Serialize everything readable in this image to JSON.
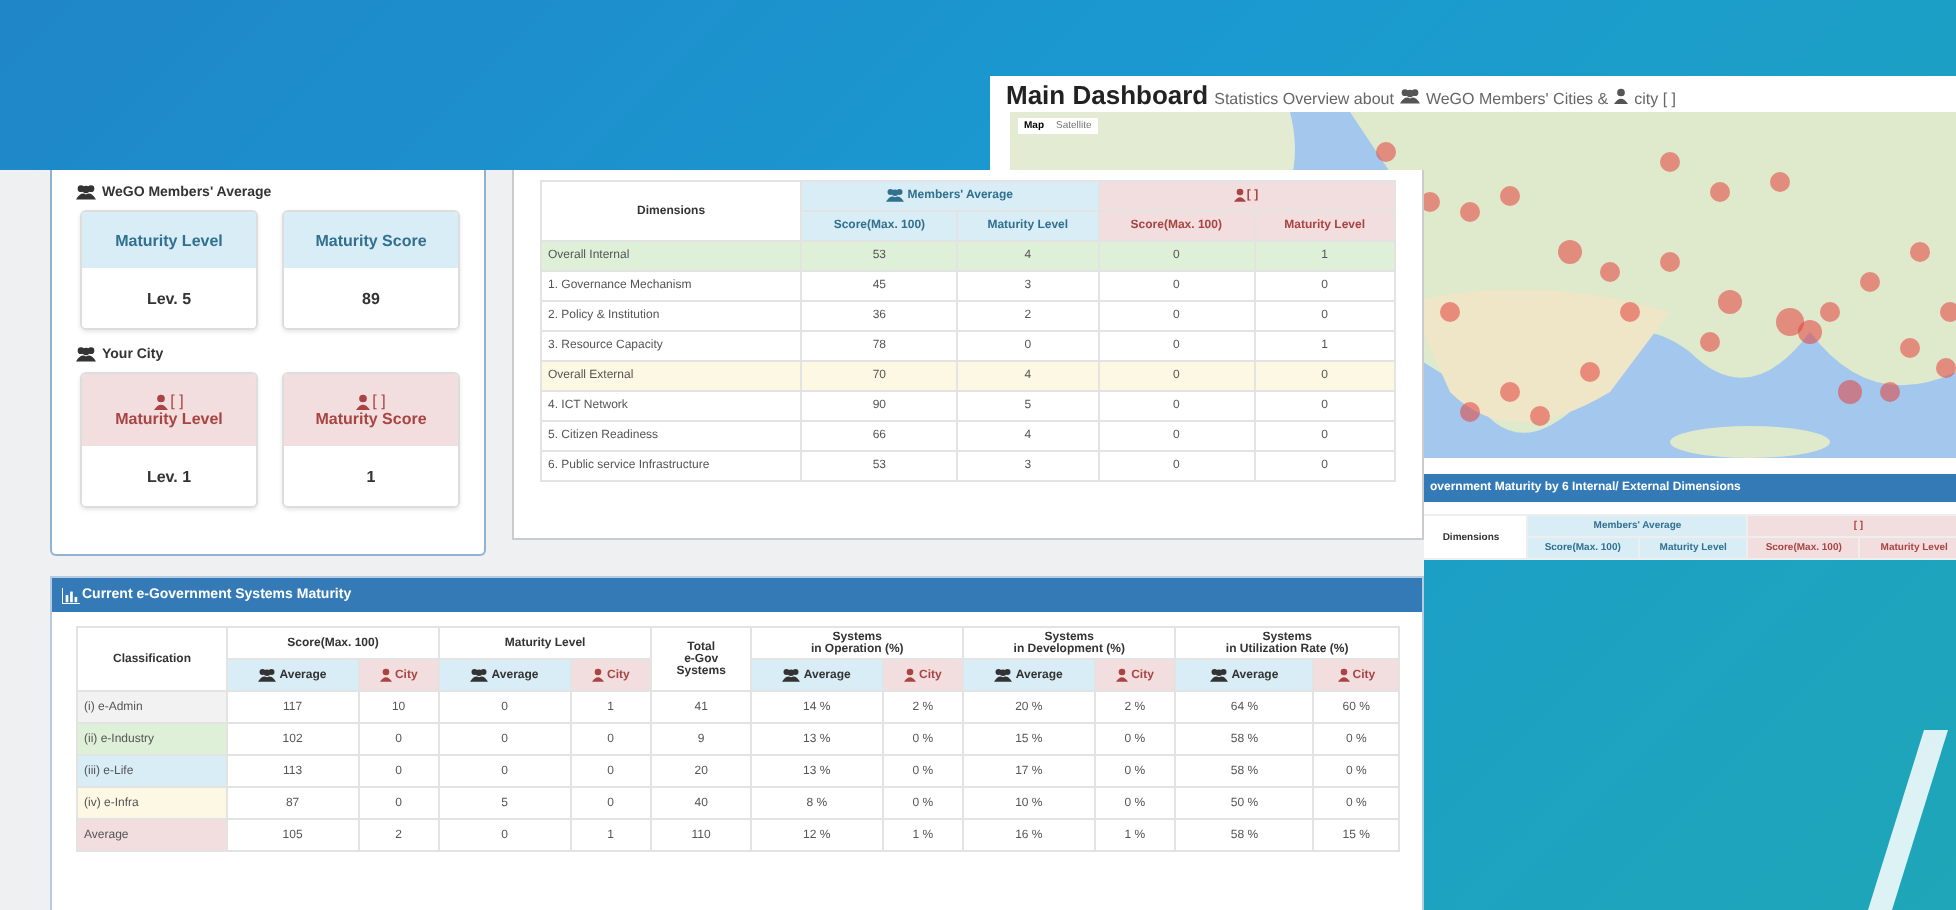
{
  "back_window": {
    "title": "Main Dashboard",
    "subtitle": "Statistics Overview about",
    "members_label": "WeGO Members' Cities &",
    "city_label": "city [ ]",
    "map_buttons": [
      {
        "label": "Map",
        "selected": true
      },
      {
        "label": "Satellite",
        "selected": false
      }
    ],
    "section_title": "overnment Maturity by 6 Internal/ External Dimensions",
    "table_header": {
      "dimensions": "Dimensions",
      "members": "Members' Average",
      "city": "[ ]",
      "sub": [
        "Score(Max. 100)",
        "Maturity Level",
        "Score(Max. 100)",
        "Maturity Level"
      ]
    }
  },
  "members_average": {
    "heading": "WeGO Members' Average",
    "cards": [
      {
        "label": "Maturity Level",
        "value": "Lev. 5"
      },
      {
        "label": "Maturity Score",
        "value": "89"
      }
    ]
  },
  "your_city": {
    "heading": "Your City",
    "cards": [
      {
        "city": "[ ]",
        "label": "Maturity Level",
        "value": "Lev. 1"
      },
      {
        "city": "[ ]",
        "label": "Maturity Score",
        "value": "1"
      }
    ]
  },
  "dimensions_table": {
    "dimensions": "Dimensions",
    "members": "Members' Average",
    "city": "[ ]",
    "sub": [
      "Score(Max. 100)",
      "Maturity Level",
      "Score(Max. 100)",
      "Maturity Level"
    ],
    "rows": [
      {
        "cells": [
          "Overall Internal",
          "53",
          "4",
          "0",
          "1"
        ],
        "color": "#dff0d8"
      },
      {
        "cells": [
          "1. Governance Mechanism",
          "45",
          "3",
          "0",
          "0"
        ],
        "color": "#ffffff"
      },
      {
        "cells": [
          "2. Policy & Institution",
          "36",
          "2",
          "0",
          "0"
        ],
        "color": "#ffffff"
      },
      {
        "cells": [
          "3. Resource Capacity",
          "78",
          "0",
          "0",
          "1"
        ],
        "color": "#ffffff"
      },
      {
        "cells": [
          "Overall External",
          "70",
          "4",
          "0",
          "0"
        ],
        "color": "#fcf8e3"
      },
      {
        "cells": [
          "4. ICT Network",
          "90",
          "5",
          "0",
          "0"
        ],
        "color": "#ffffff"
      },
      {
        "cells": [
          "5. Citizen Readiness",
          "66",
          "4",
          "0",
          "0"
        ],
        "color": "#ffffff"
      },
      {
        "cells": [
          "6. Public service Infrastructure",
          "53",
          "3",
          "0",
          "0"
        ],
        "color": "#ffffff"
      }
    ]
  },
  "systems": {
    "title": "Current e-Government Systems Maturity",
    "classification": "Classification",
    "total": "Total\ne-Gov\nSystems",
    "groups": [
      {
        "label": "Score(Max. 100)",
        "sub": [
          {
            "kind": "members",
            "label": "Average"
          },
          {
            "kind": "city",
            "label": "City"
          }
        ]
      },
      {
        "label": "Maturity Level",
        "sub": [
          {
            "kind": "members",
            "label": "Average"
          },
          {
            "kind": "city",
            "label": "City"
          }
        ]
      },
      {
        "label": "Systems\nin Operation (%)",
        "sub": [
          {
            "kind": "members",
            "label": "Average"
          },
          {
            "kind": "city",
            "label": "City"
          }
        ]
      },
      {
        "label": "Systems\nin Development (%)",
        "sub": [
          {
            "kind": "members",
            "label": "Average"
          },
          {
            "kind": "city",
            "label": "City"
          }
        ]
      },
      {
        "label": "Systems\nin Utilization Rate (%)",
        "sub": [
          {
            "kind": "members",
            "label": "Average"
          },
          {
            "kind": "city",
            "label": "City"
          }
        ]
      }
    ],
    "rows": [
      {
        "cells": [
          "(i) e-Admin",
          "117",
          "10",
          "0",
          "1",
          "41",
          "14 %",
          "2 %",
          "20 %",
          "2 %",
          "64 %",
          "60 %"
        ],
        "color": "#f2f2f2"
      },
      {
        "cells": [
          "(ii) e-Industry",
          "102",
          "0",
          "0",
          "0",
          "9",
          "13 %",
          "0 %",
          "15 %",
          "0 %",
          "58 %",
          "0 %"
        ],
        "color": "#dff0d8"
      },
      {
        "cells": [
          "(iii) e-Life",
          "113",
          "0",
          "0",
          "0",
          "20",
          "13 %",
          "0 %",
          "17 %",
          "0 %",
          "58 %",
          "0 %"
        ],
        "color": "#d9edf7"
      },
      {
        "cells": [
          "(iv) e-Infra",
          "87",
          "0",
          "5",
          "0",
          "40",
          "8 %",
          "0 %",
          "10 %",
          "0 %",
          "50 %",
          "0 %"
        ],
        "color": "#fcf8e3"
      },
      {
        "cells": [
          "Average",
          "105",
          "2",
          "0",
          "1",
          "110",
          "12 %",
          "1 %",
          "16 %",
          "1 %",
          "58 %",
          "15 %"
        ],
        "color": "#f2dede"
      }
    ]
  }
}
